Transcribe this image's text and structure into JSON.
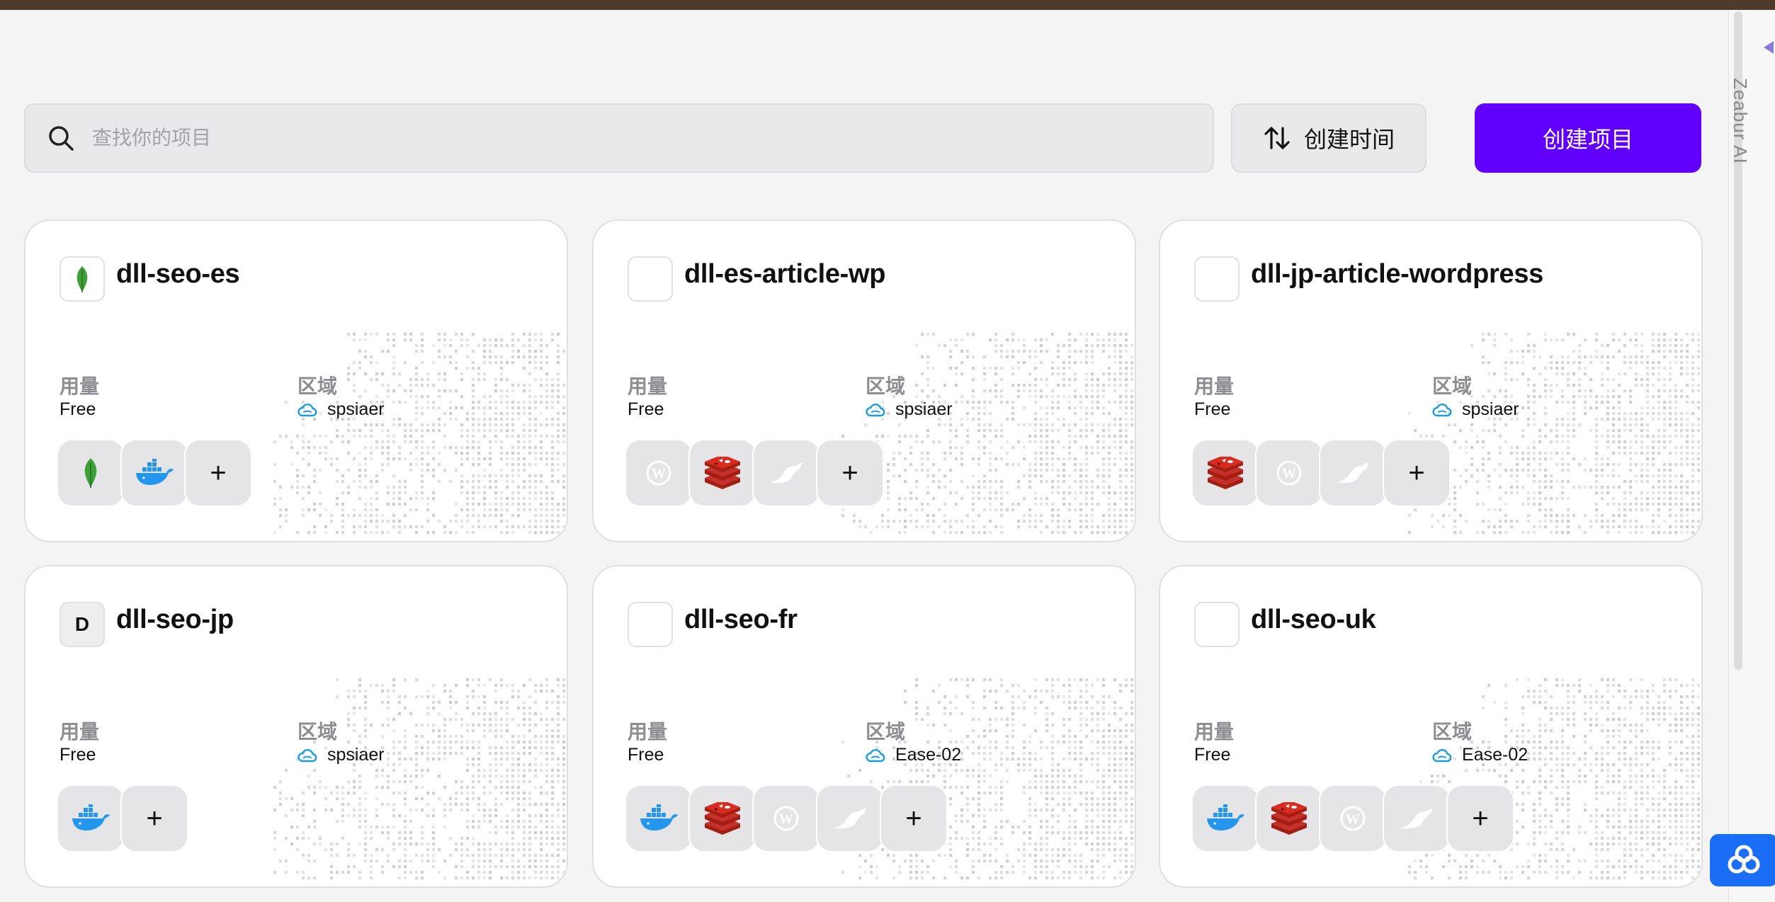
{
  "toolbar": {
    "search_placeholder": "查找你的项目",
    "sort_label": "创建时间",
    "create_label": "创建项目"
  },
  "side_rail": {
    "label": "Zeabur AI"
  },
  "projects": [
    {
      "name": "dll-seo-es",
      "logo": "mongodb-icon",
      "usage_label": "用量",
      "usage": "Free",
      "region_label": "区域",
      "region": "spsiaer",
      "services": [
        "mongodb-icon",
        "docker-icon"
      ]
    },
    {
      "name": "dll-es-article-wp",
      "logo": "",
      "usage_label": "用量",
      "usage": "Free",
      "region_label": "区域",
      "region": "spsiaer",
      "services": [
        "wordpress-icon",
        "redis-icon",
        "mariadb-icon"
      ]
    },
    {
      "name": "dll-jp-article-wordpress",
      "logo": "",
      "usage_label": "用量",
      "usage": "Free",
      "region_label": "区域",
      "region": "spsiaer",
      "services": [
        "redis-icon",
        "wordpress-icon",
        "mariadb-icon"
      ]
    },
    {
      "name": "dll-seo-jp",
      "logo": "D",
      "usage_label": "用量",
      "usage": "Free",
      "region_label": "区域",
      "region": "spsiaer",
      "services": [
        "docker-icon"
      ]
    },
    {
      "name": "dll-seo-fr",
      "logo": "",
      "usage_label": "用量",
      "usage": "Free",
      "region_label": "区域",
      "region": "Ease-02",
      "services": [
        "docker-icon",
        "redis-icon",
        "wordpress-icon",
        "mariadb-icon"
      ]
    },
    {
      "name": "dll-seo-uk",
      "logo": "",
      "usage_label": "用量",
      "usage": "Free",
      "region_label": "区域",
      "region": "Ease-02",
      "services": [
        "docker-icon",
        "redis-icon",
        "wordpress-icon",
        "mariadb-icon"
      ]
    }
  ],
  "add_service_label": "+",
  "colors": {
    "accent": "#6200ff",
    "top_strip": "#4f3b2c",
    "mongodb": "#3fa037",
    "docker": "#2496ed",
    "redis": "#c6302b",
    "cloud": "#1a9de0"
  }
}
